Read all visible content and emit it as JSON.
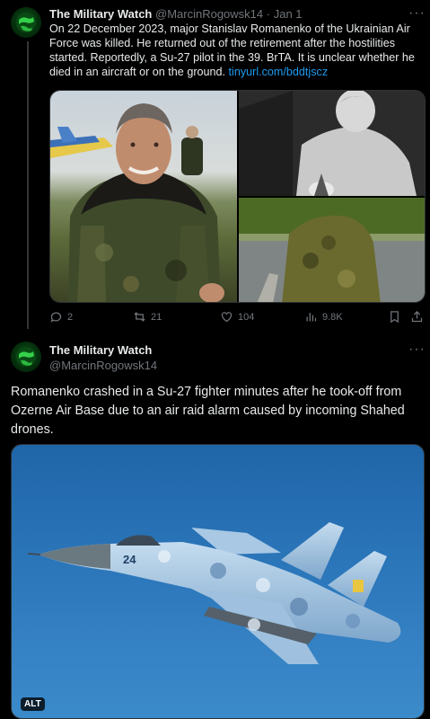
{
  "tweet1": {
    "author_name": "The Military Watch",
    "handle": "@MarcinRogowsk14",
    "separator": "·",
    "date": "Jan 1",
    "text": "On 22 December 2023, major Stanislav Romanenko of the Ukrainian Air Force was killed. He returned out of the retirement after the hostilities started. Reportedly, a Su-27 pilot in the 39. BrTA. It is unclear whether he died in an aircraft or on the ground. ",
    "link": "tinyurl.com/bddtjscz",
    "more": "···",
    "actions": {
      "replies": "2",
      "reposts": "21",
      "likes": "104",
      "views": "9.8K"
    }
  },
  "tweet2": {
    "author_name": "The Military Watch",
    "handle": "@MarcinRogowsk14",
    "more": "···",
    "text": "Romanenko crashed in a Su-27 fighter minutes after he took-off from Ozerne Air Base due to an air raid alarm caused by incoming Shahed drones.",
    "alt_badge": "ALT",
    "jet_number": "24"
  },
  "colors": {
    "background": "#000000",
    "text_primary": "#e7e9ea",
    "text_secondary": "#71767b",
    "link": "#1d9bf0",
    "divider": "#2f3336"
  },
  "icons": {
    "reply": "reply-icon",
    "repost": "repost-icon",
    "like": "heart-icon",
    "views": "views-chart-icon",
    "bookmark": "bookmark-icon",
    "share": "share-icon",
    "more": "more-horizontal-icon"
  }
}
